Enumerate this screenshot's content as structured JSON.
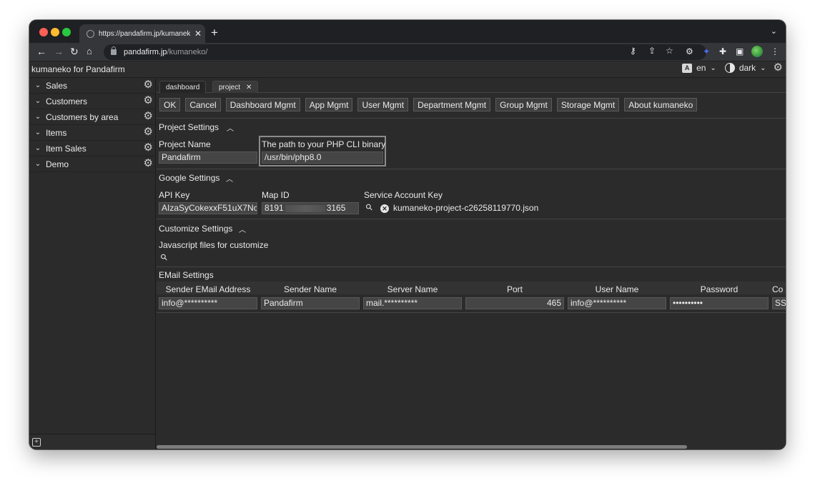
{
  "browser": {
    "tab_title": "https://pandafirm.jp/kumaneko/",
    "url_host": "pandafirm.jp",
    "url_path": "/kumaneko/"
  },
  "app": {
    "title": "kumaneko for Pandafirm",
    "language": "en",
    "theme": "dark"
  },
  "sidebar": {
    "items": [
      {
        "label": "Sales"
      },
      {
        "label": "Customers"
      },
      {
        "label": "Customers by area"
      },
      {
        "label": "Items"
      },
      {
        "label": "Item Sales"
      },
      {
        "label": "Demo"
      }
    ]
  },
  "page_tabs": [
    {
      "label": "dashboard"
    },
    {
      "label": "project"
    }
  ],
  "toolbar": {
    "buttons": [
      "OK",
      "Cancel",
      "Dashboard Mgmt",
      "App Mgmt",
      "User Mgmt",
      "Department Mgmt",
      "Group Mgmt",
      "Storage Mgmt",
      "About kumaneko"
    ]
  },
  "project_settings": {
    "title": "Project Settings",
    "project_name_label": "Project Name",
    "project_name_value": "Pandafirm",
    "php_label": "The path to your PHP CLI binary",
    "php_value": "/usr/bin/php8.0"
  },
  "google_settings": {
    "title": "Google Settings",
    "api_key_label": "API Key",
    "api_key_value": "AIzaSyCokexxF51uX7Nc",
    "map_id_label": "Map ID",
    "map_id_prefix": "8191",
    "map_id_suffix": "3165",
    "service_key_label": "Service Account Key",
    "service_key_file": "kumaneko-project-c26258119770.json"
  },
  "customize_settings": {
    "title": "Customize Settings",
    "js_label": "Javascript files for customize"
  },
  "email_settings": {
    "title": "EMail Settings",
    "columns": [
      "Sender EMail Address",
      "Sender Name",
      "Server Name",
      "Port",
      "User Name",
      "Password",
      "Co"
    ],
    "values": [
      "info@**********",
      "Pandafirm",
      "mail.**********",
      "465",
      "info@**********",
      "••••••••••",
      "SS"
    ]
  }
}
